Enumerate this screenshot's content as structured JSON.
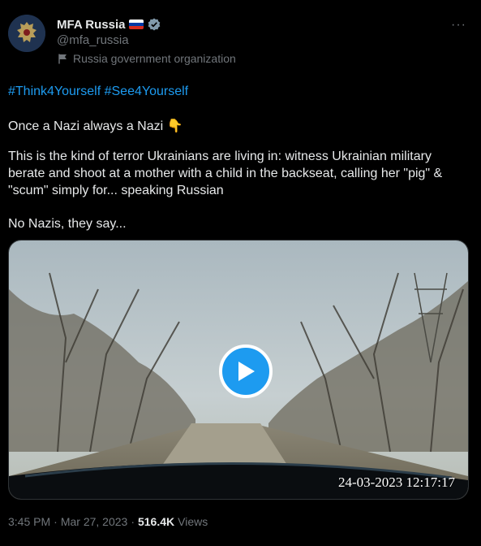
{
  "author": {
    "display_name": "MFA Russia",
    "handle": "@mfa_russia",
    "affiliation": "Russia government organization",
    "flag_colors": [
      "#ffffff",
      "#0039a6",
      "#d52b1e"
    ],
    "verified_color": "#829aab"
  },
  "menu": {
    "more_label": "···"
  },
  "tweet": {
    "hashtags": [
      "#Think4Yourself",
      "#See4Yourself"
    ],
    "line1": "Once a Nazi always a Nazi 👇",
    "line2": "This is the kind of terror Ukrainians are living in: witness Ukrainian military berate and shoot at a mother with a child in the backseat, calling her \"pig\" & \"scum\" simply for... speaking Russian",
    "line3": "No Nazis, they say..."
  },
  "media": {
    "type": "video",
    "overlay_timestamp": "24-03-2023 12:17:17",
    "play_icon": "play-icon"
  },
  "meta": {
    "time": "3:45 PM",
    "date": "Mar 27, 2023",
    "views_count": "516.4K",
    "views_label": "Views"
  },
  "colors": {
    "accent": "#1d9bf0",
    "background": "#000000",
    "secondary_text": "#71767b"
  }
}
